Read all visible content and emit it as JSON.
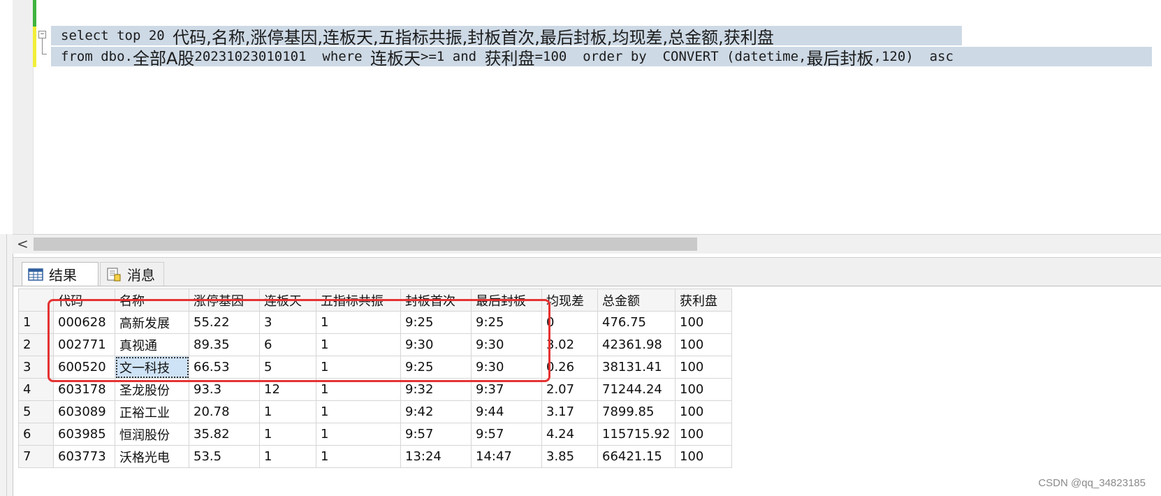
{
  "editor": {
    "line1": {
      "kw": "select top 20 ",
      "cols": "代码,名称,涨停基因,连板天,五指标共振,封板首次,最后封板,均现差,总金额,获利盘"
    },
    "line2": {
      "p1": "from dbo.",
      "t1": "全部A股",
      "p2": "20231023010101  where ",
      "t2": "连板天",
      "p3": ">=1 and ",
      "t3": "获利盘",
      "p4": "=100  order by  CONVERT (datetime,",
      "t4": "最后封板",
      "p5": ",120)  asc"
    },
    "fold_symbol": "−"
  },
  "scrollbar": {
    "left_arrow": "<"
  },
  "tabs": [
    {
      "label": "结果",
      "icon": "grid-icon"
    },
    {
      "label": "消息",
      "icon": "messages-icon"
    }
  ],
  "grid": {
    "headers": [
      "代码",
      "名称",
      "涨停基因",
      "连板天",
      "五指标共振",
      "封板首次",
      "最后封板",
      "均现差",
      "总金额",
      "获利盘"
    ],
    "rows": [
      [
        "1",
        "000628",
        "高新发展",
        "55.22",
        "3",
        "1",
        "9:25",
        "9:25",
        "0",
        "476.75",
        "100"
      ],
      [
        "2",
        "002771",
        "真视通",
        "89.35",
        "6",
        "1",
        "9:30",
        "9:30",
        "3.02",
        "42361.98",
        "100"
      ],
      [
        "3",
        "600520",
        "文一科技",
        "66.53",
        "5",
        "1",
        "9:25",
        "9:30",
        "0.26",
        "38131.41",
        "100"
      ],
      [
        "4",
        "603178",
        "圣龙股份",
        "93.3",
        "12",
        "1",
        "9:32",
        "9:37",
        "2.07",
        "71244.24",
        "100"
      ],
      [
        "5",
        "603089",
        "正裕工业",
        "20.78",
        "1",
        "1",
        "9:42",
        "9:44",
        "3.17",
        "7899.85",
        "100"
      ],
      [
        "6",
        "603985",
        "恒润股份",
        "35.82",
        "1",
        "1",
        "9:57",
        "9:57",
        "4.24",
        "115715.92",
        "100"
      ],
      [
        "7",
        "603773",
        "沃格光电",
        "53.5",
        "1",
        "1",
        "13:24",
        "14:47",
        "3.85",
        "66421.15",
        "100"
      ]
    ]
  },
  "watermark": "CSDN @qq_34823185",
  "colors": {
    "selection": "#cdd9e5",
    "highlight_box": "#e53333",
    "cell_selected": "#cfe3f6"
  }
}
